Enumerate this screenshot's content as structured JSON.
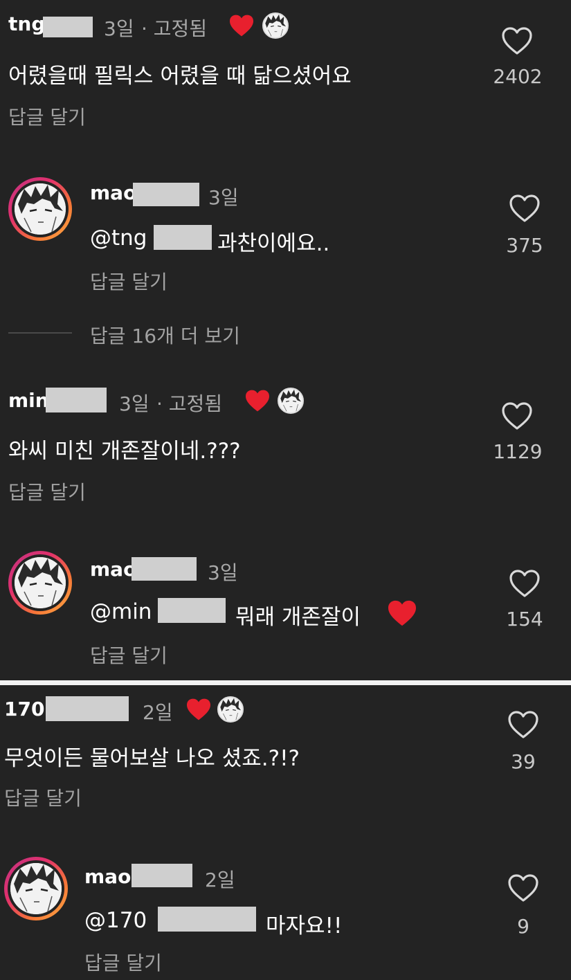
{
  "comments": [
    {
      "username": "tng",
      "time": "3일",
      "pinned": "· 고정됨",
      "text": "어렸을때 필릭스 어렸을 때 닮으셨어요",
      "reply_label": "답글 달기",
      "likes": "2402",
      "reply": {
        "username": "mao",
        "time": "3일",
        "mention": "@tng",
        "text": "과찬이에요..",
        "reply_label": "답글 달기",
        "likes": "375"
      },
      "more_replies": "답글 16개 더 보기"
    },
    {
      "username": "min",
      "time": "3일",
      "pinned": "· 고정됨",
      "text": "와씨 미친 개존잘이네.???",
      "reply_label": "답글 달기",
      "likes": "1129",
      "reply": {
        "username": "mao",
        "time": "3일",
        "mention": "@min",
        "text": "뭐래 개존잘이",
        "reply_label": "답글 달기",
        "likes": "154"
      }
    },
    {
      "username": "170",
      "time": "2일",
      "text": "무엇이든 물어보살 나오 셨죠.?!?",
      "reply_label": "답글 달기",
      "likes": "39",
      "reply": {
        "username": "mao",
        "time": "2일",
        "mention": "@170",
        "text": "마자요!!",
        "reply_label": "답글 달기",
        "likes": "9"
      }
    }
  ],
  "icons": {
    "like": "heart-outline-icon",
    "creator_liked": "red-heart-icon",
    "creator_avatar": "creator-avatar-icon"
  },
  "colors": {
    "background": "#232323",
    "heart_red": "#e8202e",
    "secondary_text": "#a9a9a9",
    "divider": "#f2f2f2"
  }
}
